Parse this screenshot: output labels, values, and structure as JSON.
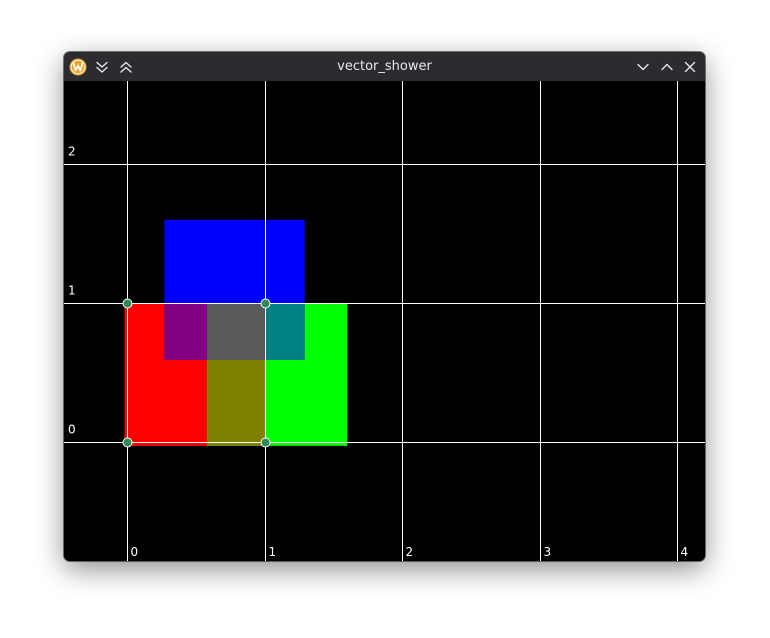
{
  "window": {
    "title": "vector_shower",
    "app_icon": "w-logo-icon",
    "buttons": {
      "keep_below": "chevrons-down-icon",
      "keep_above": "chevrons-up-icon",
      "minimize": "chevron-down-icon",
      "maximize": "chevron-up-icon",
      "close": "close-icon"
    }
  },
  "plot": {
    "background": "#000000",
    "grid_color": "#ffffff",
    "x_range": [
      -0.46,
      4.2
    ],
    "y_range": [
      -0.86,
      2.6
    ],
    "x_ticks": [
      {
        "value": 0,
        "label": "0"
      },
      {
        "value": 1,
        "label": "1"
      },
      {
        "value": 2,
        "label": "2"
      },
      {
        "value": 3,
        "label": "3"
      },
      {
        "value": 4,
        "label": "4"
      }
    ],
    "y_ticks": [
      {
        "value": 0,
        "label": "0"
      },
      {
        "value": 1,
        "label": "1"
      },
      {
        "value": 2,
        "label": "2"
      }
    ],
    "rects": [
      {
        "name": "red-rect",
        "x0": -0.02,
        "x1": 0.58,
        "y0": -0.03,
        "y1": 1.0,
        "color": "#ff0000"
      },
      {
        "name": "green-rect",
        "x0": 0.58,
        "x1": 1.6,
        "y0": -0.03,
        "y1": 1.0,
        "color": "#00ff00"
      },
      {
        "name": "blue-rect",
        "x0": 0.27,
        "x1": 1.29,
        "y0": 0.59,
        "y1": 1.6,
        "color": "#0000ff"
      },
      {
        "name": "purple-overlap-rect",
        "x0": 0.27,
        "x1": 0.58,
        "y0": 0.59,
        "y1": 1.0,
        "color": "#800080"
      },
      {
        "name": "gray-overlap-rect",
        "x0": 0.58,
        "x1": 1.0,
        "y0": 0.59,
        "y1": 1.0,
        "color": "#5a5a5a"
      },
      {
        "name": "teal-overlap-rect",
        "x0": 1.0,
        "x1": 1.29,
        "y0": 0.59,
        "y1": 1.0,
        "color": "#008080"
      },
      {
        "name": "olive-overlap-rect",
        "x0": 0.58,
        "x1": 1.0,
        "y0": -0.03,
        "y1": 0.59,
        "color": "#808000"
      }
    ],
    "points": [
      {
        "name": "point-origin",
        "x": 0,
        "y": 0
      },
      {
        "name": "point-1-0",
        "x": 1,
        "y": 0
      },
      {
        "name": "point-0-1",
        "x": 0,
        "y": 1
      },
      {
        "name": "point-1-1",
        "x": 1,
        "y": 1
      }
    ],
    "point_color": "#2e8b57"
  }
}
